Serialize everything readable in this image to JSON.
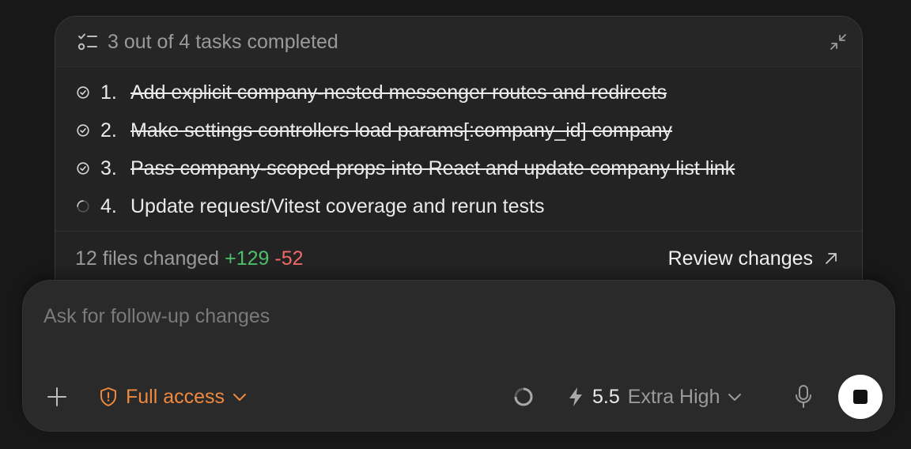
{
  "task_panel": {
    "summary": "3 out of 4 tasks completed",
    "summary_icon": "checklist-icon",
    "collapse_icon": "collapse-icon",
    "tasks": [
      {
        "number": "1.",
        "text": "Add explicit company-nested messenger routes and redirects",
        "status": "done"
      },
      {
        "number": "2.",
        "text": "Make settings controllers load params[:company_id] company",
        "status": "done"
      },
      {
        "number": "3.",
        "text": "Pass company-scoped props into React and update company list link",
        "status": "done"
      },
      {
        "number": "4.",
        "text": "Update request/Vitest coverage and rerun tests",
        "status": "in-progress"
      }
    ],
    "files_changed": "12 files changed",
    "additions": "+129",
    "deletions": "-52",
    "review_label": "Review changes",
    "review_icon": "arrow-up-right-icon"
  },
  "composer": {
    "placeholder": "Ask for follow-up changes",
    "value": "",
    "access_label": "Full access",
    "model_version": "5.5",
    "model_effort": "Extra High"
  },
  "colors": {
    "background": "#181818",
    "card": "#232323",
    "composer": "#2a2a2a",
    "additions": "#4cc06a",
    "deletions": "#f06a6a",
    "access": "#f0893f"
  }
}
